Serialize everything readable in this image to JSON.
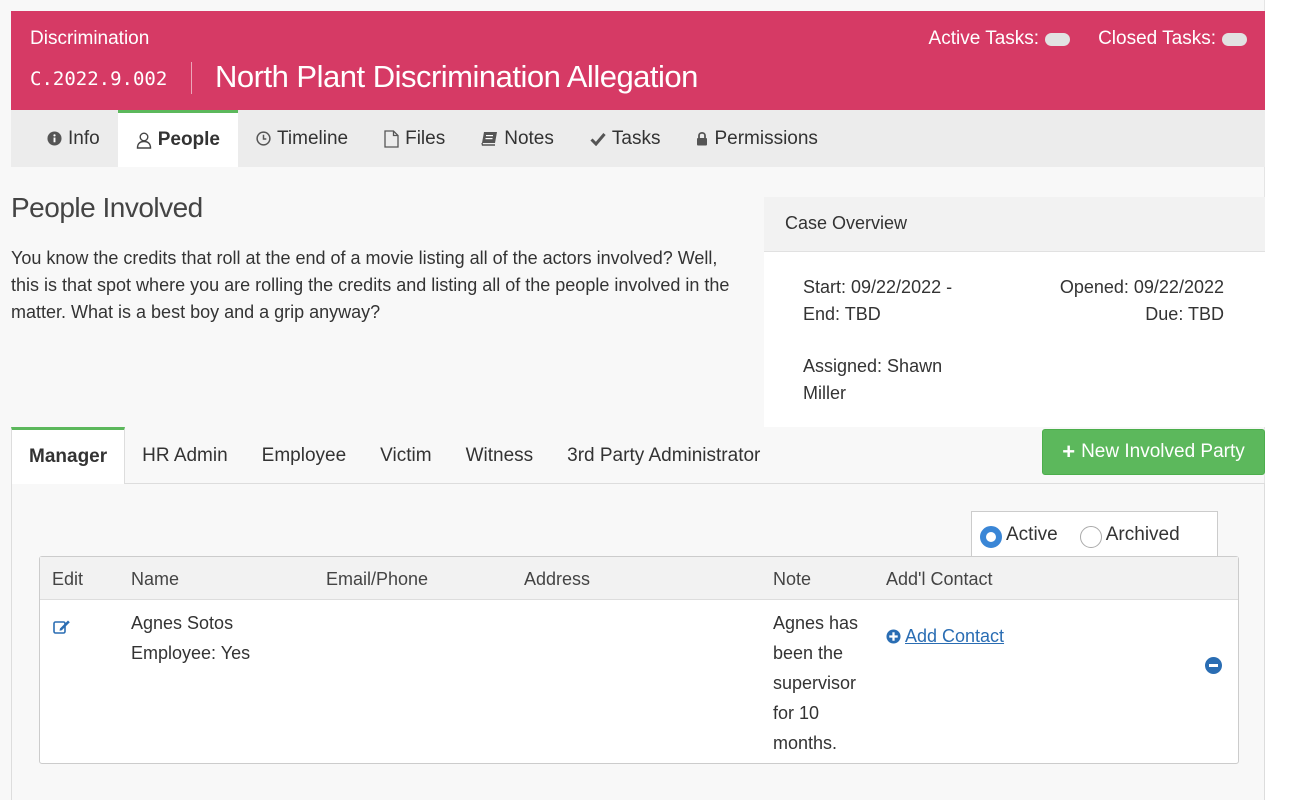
{
  "header": {
    "category": "Discrimination",
    "case_number": "C.2022.9.002",
    "title": "North Plant Discrimination Allegation",
    "active_tasks_label": "Active Tasks:",
    "closed_tasks_label": "Closed Tasks:"
  },
  "tabs": [
    {
      "label": "Info",
      "icon": "info-circle-icon"
    },
    {
      "label": "People",
      "icon": "user-icon"
    },
    {
      "label": "Timeline",
      "icon": "clock-icon"
    },
    {
      "label": "Files",
      "icon": "file-icon"
    },
    {
      "label": "Notes",
      "icon": "book-icon"
    },
    {
      "label": "Tasks",
      "icon": "check-icon"
    },
    {
      "label": "Permissions",
      "icon": "lock-icon"
    }
  ],
  "people": {
    "title": "People Involved",
    "intro": "You know the credits that roll at the end of a movie listing all of the actors involved? Well, this is that spot where you are rolling the credits and listing all of the people involved in the matter. What is a best boy and a grip anyway?"
  },
  "overview": {
    "heading": "Case Overview",
    "start": "Start: 09/22/2022 -",
    "end": "End: TBD",
    "opened": "Opened: 09/22/2022",
    "due": "Due: TBD",
    "assigned_1": "Assigned: Shawn",
    "assigned_2": "Miller"
  },
  "role_tabs": [
    "Manager",
    "HR Admin",
    "Employee",
    "Victim",
    "Witness",
    "3rd Party Administrator"
  ],
  "new_party_button": "New Involved Party",
  "filter": {
    "active": "Active",
    "archived": "Archived",
    "selected": "Active"
  },
  "table": {
    "headers": [
      "Edit",
      "Name",
      "Email/Phone",
      "Address",
      "Note",
      "Add'l Contact"
    ],
    "rows": [
      {
        "name": "Agnes Sotos",
        "employee": "Employee: Yes",
        "note_lines": [
          "Agnes has",
          "been the",
          "supervisor",
          "for 10",
          "months."
        ],
        "add_contact": "Add Contact"
      }
    ]
  },
  "colors": {
    "header": "#d63a65",
    "accent_green": "#5cb85c",
    "link_blue": "#2a6db3"
  }
}
